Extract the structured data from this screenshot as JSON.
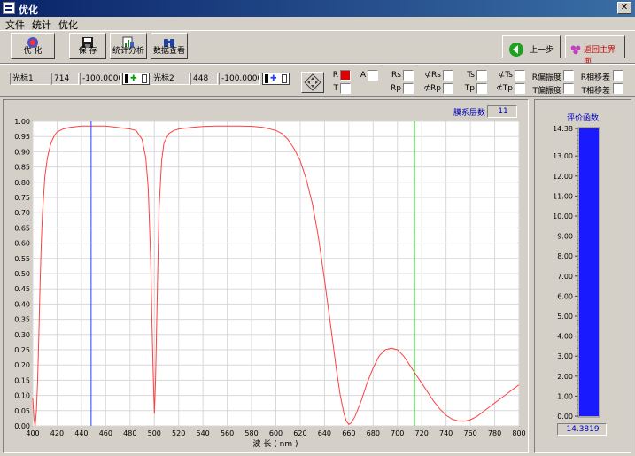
{
  "window": {
    "title": "优化",
    "close_glyph": "✕"
  },
  "menu": [
    {
      "label": "文件"
    },
    {
      "label": "统计"
    },
    {
      "label": "优化"
    }
  ],
  "toolbar": {
    "optimize_label": "优 化",
    "save_label": "保 存",
    "stats_label": "统计分析",
    "data_label": "数据查看",
    "prev_label": "上一步",
    "home_label": "返回主界面"
  },
  "cursor1": {
    "name": "光标1",
    "x": "714",
    "y": "-100.0000"
  },
  "cursor2": {
    "name": "光标2",
    "x": "448",
    "y": "-100.0000"
  },
  "checkboxes": {
    "R": true,
    "A": false,
    "T": false,
    "Rs": false,
    "Rp": false,
    "phiRs": false,
    "phiRp": false,
    "Ts": false,
    "Tp": false,
    "phiTs": false,
    "phiTp": false,
    "Rpol": false,
    "Tpol": false,
    "Rphase": false,
    "Tphase": false
  },
  "labels": {
    "R": "R",
    "A": "A",
    "T": "T",
    "Rs": "Rs",
    "Rp": "Rp",
    "phiRs": "⊄Rs",
    "phiRp": "⊄Rp",
    "Ts": "Ts",
    "Tp": "Tp",
    "phiTs": "⊄Ts",
    "phiTp": "⊄Tp",
    "Rpol": "R偏振度",
    "Tpol": "T偏振度",
    "Rphase": "R相移差",
    "Tphase": "T相移差"
  },
  "layers": {
    "label": "膜系层数",
    "value": "11"
  },
  "merit": {
    "label": "评价函数",
    "value": "14.3819",
    "level": 14.3819,
    "max_label": "14.38",
    "max": 14.38
  },
  "colors": {
    "curve": "#ff4040",
    "cursor1": "#00c000",
    "cursor2": "#2040ff",
    "gauge_fill": "#1a1aff"
  },
  "chart_data": {
    "type": "line",
    "xlabel": "波 长 ( nm )",
    "ylabel": "",
    "xlim": [
      400,
      800
    ],
    "ylim": [
      0,
      1
    ],
    "x_ticks": [
      "400",
      "420",
      "440",
      "460",
      "480",
      "500",
      "520",
      "540",
      "560",
      "580",
      "600",
      "620",
      "640",
      "660",
      "680",
      "700",
      "720",
      "740",
      "760",
      "780",
      "800"
    ],
    "y_ticks": [
      "0.00",
      "0.05",
      "0.10",
      "0.15",
      "0.20",
      "0.25",
      "0.30",
      "0.35",
      "0.40",
      "0.45",
      "0.50",
      "0.55",
      "0.60",
      "0.65",
      "0.70",
      "0.75",
      "0.80",
      "0.85",
      "0.90",
      "0.95",
      "1.00"
    ],
    "cursors": [
      {
        "x": 714
      },
      {
        "x": 448
      }
    ],
    "series": [
      {
        "name": "R",
        "x": [
          400,
          401,
          402,
          403,
          404,
          405,
          406,
          407,
          408,
          410,
          412,
          415,
          418,
          420,
          425,
          430,
          440,
          450,
          460,
          470,
          480,
          485,
          490,
          493,
          495,
          497,
          498,
          499,
          500,
          501,
          502,
          503,
          504,
          506,
          508,
          512,
          516,
          520,
          530,
          540,
          550,
          560,
          570,
          580,
          590,
          600,
          605,
          610,
          615,
          620,
          625,
          630,
          635,
          640,
          645,
          650,
          653,
          656,
          658,
          660,
          662,
          665,
          670,
          675,
          680,
          685,
          690,
          695,
          700,
          705,
          710,
          715,
          720,
          725,
          730,
          735,
          740,
          745,
          750,
          755,
          760,
          765,
          770,
          775,
          780,
          785,
          790,
          795,
          800
        ],
        "y": [
          0.09,
          0.02,
          0.0,
          0.05,
          0.15,
          0.3,
          0.46,
          0.6,
          0.7,
          0.82,
          0.88,
          0.93,
          0.955,
          0.965,
          0.975,
          0.98,
          0.985,
          0.985,
          0.985,
          0.98,
          0.975,
          0.97,
          0.94,
          0.88,
          0.78,
          0.55,
          0.35,
          0.18,
          0.04,
          0.15,
          0.35,
          0.55,
          0.72,
          0.87,
          0.93,
          0.96,
          0.97,
          0.975,
          0.98,
          0.983,
          0.985,
          0.985,
          0.985,
          0.984,
          0.98,
          0.97,
          0.96,
          0.94,
          0.91,
          0.87,
          0.81,
          0.73,
          0.62,
          0.48,
          0.33,
          0.18,
          0.1,
          0.04,
          0.015,
          0.005,
          0.01,
          0.03,
          0.08,
          0.14,
          0.19,
          0.23,
          0.25,
          0.255,
          0.25,
          0.23,
          0.2,
          0.17,
          0.14,
          0.11,
          0.08,
          0.055,
          0.035,
          0.022,
          0.016,
          0.015,
          0.02,
          0.03,
          0.045,
          0.06,
          0.075,
          0.09,
          0.105,
          0.12,
          0.135
        ]
      }
    ]
  }
}
